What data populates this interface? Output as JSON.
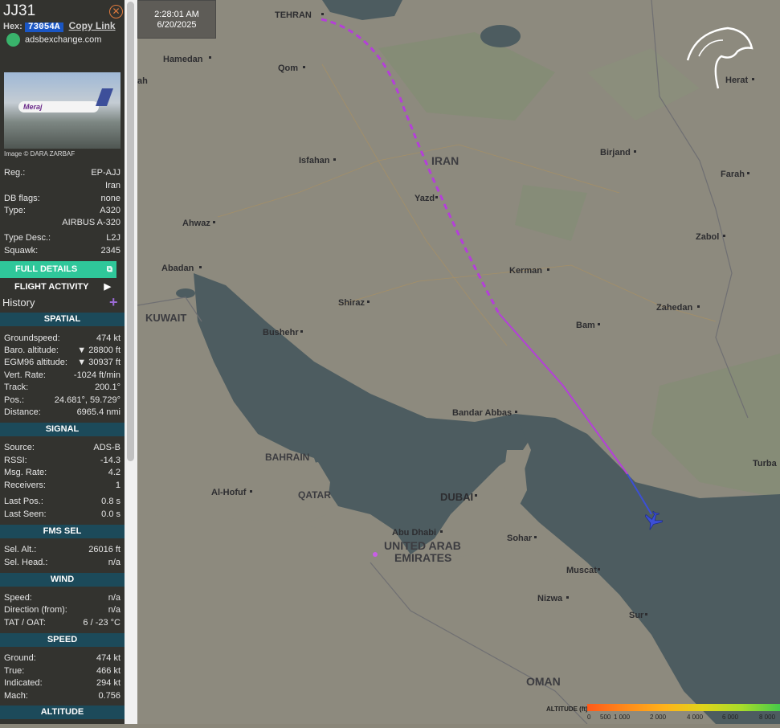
{
  "sidebar": {
    "callsign": "JJ31",
    "hex_label": "Hex:",
    "hex_value": "73054A",
    "copy_link": "Copy Link",
    "site": "adsbexchange.com",
    "image_credit": "Image © DARA ZARBAF",
    "photo_livery": "Meraj",
    "info": [
      {
        "k": "Reg.:",
        "v": "EP-AJJ"
      },
      {
        "k": "",
        "v": "Iran"
      },
      {
        "k": "DB flags:",
        "v": "none"
      },
      {
        "k": "Type:",
        "v": "A320"
      },
      {
        "k": "",
        "v": "AIRBUS A-320"
      },
      {
        "k": "Type Desc.:",
        "v": "L2J"
      },
      {
        "k": "Squawk:",
        "v": "2345"
      }
    ],
    "full_details": "FULL DETAILS",
    "flight_activity": "FLIGHT ACTIVITY",
    "history": "History",
    "sections": {
      "spatial": "SPATIAL",
      "signal": "SIGNAL",
      "fms": "FMS SEL",
      "wind": "WIND",
      "speed": "SPEED",
      "altitude": "ALTITUDE"
    },
    "spatial": [
      {
        "k": "Groundspeed:",
        "v": "474 kt"
      },
      {
        "k": "Baro. altitude:",
        "v": "▼ 28800 ft"
      },
      {
        "k": "EGM96 altitude:",
        "v": "▼ 30937 ft"
      },
      {
        "k": "Vert. Rate:",
        "v": "-1024 ft/min"
      },
      {
        "k": "Track:",
        "v": "200.1°"
      },
      {
        "k": "Pos.:",
        "v": "24.681°, 59.729°"
      },
      {
        "k": "Distance:",
        "v": "6965.4 nmi"
      }
    ],
    "signal": [
      {
        "k": "Source:",
        "v": "ADS-B"
      },
      {
        "k": "RSSI:",
        "v": "-14.3"
      },
      {
        "k": "Msg. Rate:",
        "v": "4.2"
      },
      {
        "k": "Receivers:",
        "v": "1"
      },
      {
        "k": "Last Pos.:",
        "v": "0.8 s"
      },
      {
        "k": "Last Seen:",
        "v": "0.0 s"
      }
    ],
    "fms": [
      {
        "k": "Sel. Alt.:",
        "v": "26016 ft"
      },
      {
        "k": "Sel. Head.:",
        "v": "n/a"
      }
    ],
    "wind": [
      {
        "k": "Speed:",
        "v": "n/a"
      },
      {
        "k": "Direction (from):",
        "v": "n/a"
      },
      {
        "k": "TAT / OAT:",
        "v": "6 / -23 °C"
      }
    ],
    "speed": [
      {
        "k": "Ground:",
        "v": "474 kt"
      },
      {
        "k": "True:",
        "v": "466 kt"
      },
      {
        "k": "Indicated:",
        "v": "294 kt"
      },
      {
        "k": "Mach:",
        "v": "0.756"
      }
    ]
  },
  "clock": {
    "time": "2:28:01 AM",
    "date": "6/20/2025"
  },
  "map": {
    "countries": [
      "IRAN",
      "KUWAIT",
      "BAHRAIN",
      "QATAR",
      "UNITED ARAB",
      "EMIRATES",
      "OMAN"
    ],
    "cities": [
      "TEHRAN",
      "Hamedan",
      "Qom",
      "Herat",
      "Birjand",
      "Isfahan",
      "Farah",
      "Yazd",
      "Ahwaz",
      "Zabol",
      "Abadan",
      "Kerman",
      "Shiraz",
      "Zahedan",
      "Bushehr",
      "Bam",
      "Bandar Abbas",
      "Turba",
      "Al-Hofuf",
      "DUBAI",
      "Abu Dhabi",
      "Sohar",
      "Muscat",
      "Nizwa",
      "Sur",
      "ah"
    ],
    "track_color": "#b43fd9",
    "aircraft_color": "#3c4fd6"
  },
  "legend": {
    "label": "ALTITUDE (ft)",
    "ticks": [
      "0",
      "500",
      "1 000",
      "2 000",
      "4 000",
      "6 000",
      "8 000"
    ]
  }
}
